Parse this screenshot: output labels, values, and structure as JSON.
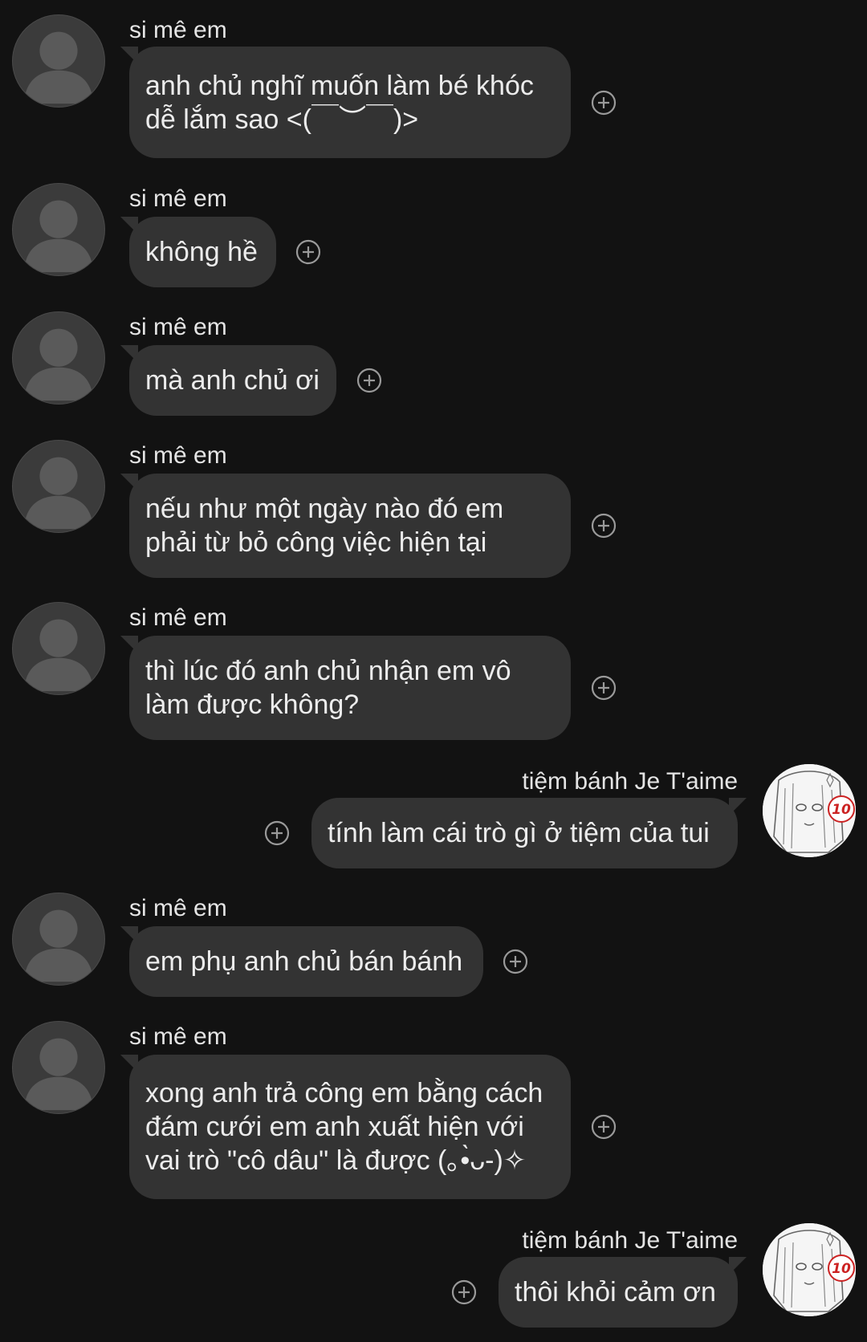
{
  "conversation": {
    "messages": [
      {
        "sender": "si mê em",
        "lines": [
          "anh chủ nghĩ muốn làm bé khóc",
          "dễ lắm sao <(￣︶￣)>"
        ]
      },
      {
        "sender": "si mê em",
        "lines": [
          "không hề"
        ]
      },
      {
        "sender": "si mê em",
        "lines": [
          "mà anh chủ ơi"
        ]
      },
      {
        "sender": "si mê em",
        "lines": [
          "nếu như một ngày nào đó em",
          "phải từ bỏ công việc hiện tại"
        ]
      },
      {
        "sender": "si mê em",
        "lines": [
          "thì lúc đó anh chủ nhận em vô",
          "làm được không?"
        ]
      },
      {
        "sender": "tiệm bánh Je T'aime",
        "lines": [
          "tính làm cái trò gì ở tiệm của tui"
        ]
      },
      {
        "sender": "si mê em",
        "lines": [
          "em phụ anh chủ bán bánh"
        ]
      },
      {
        "sender": "si mê em",
        "lines": [
          "xong anh trả công em bằng cách",
          "đám cưới em anh xuất hiện với",
          "vai trò \"cô dâu\" là được (｡•̀ᴗ-)✧"
        ]
      },
      {
        "sender": "tiệm bánh Je T'aime",
        "lines": [
          "thôi khỏi cảm ơn"
        ]
      }
    ],
    "avatar_badge": "10"
  },
  "colors": {
    "background": "#121212",
    "bubble": "#333333",
    "text": "#ececec",
    "avatar_placeholder": "#3b3b3b"
  },
  "icons": {
    "add_reaction": "plus-circle-icon",
    "default_avatar": "person-silhouette-icon"
  }
}
